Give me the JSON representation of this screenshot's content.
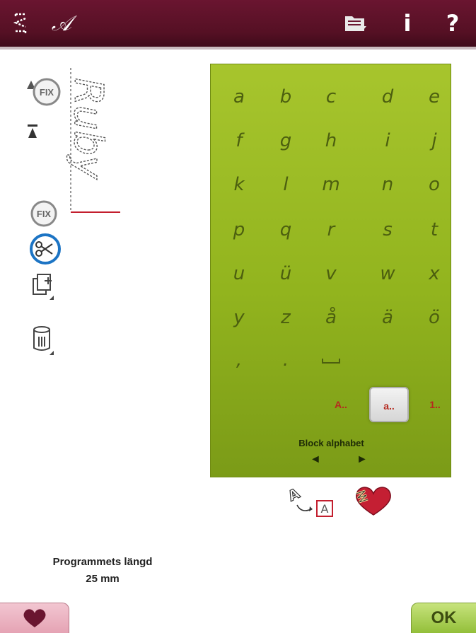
{
  "topbar": {
    "font_icon_glyph": "𝒜",
    "info_label": "i",
    "help_label": "?",
    "icons": [
      "stitch-menu-icon",
      "font-icon",
      "file-manager-icon",
      "info-icon",
      "help-icon"
    ]
  },
  "sidebar": {
    "fix_label": "FIX",
    "preview_text": "Ruby",
    "icons": [
      "fix-start-icon",
      "needle-stop-up-icon",
      "fix-end-icon",
      "scissors-icon",
      "duplicate-icon",
      "delete-icon"
    ]
  },
  "keyboard": {
    "rows": [
      [
        "a",
        "b",
        "c",
        "d",
        "e"
      ],
      [
        "f",
        "g",
        "h",
        "i",
        "j"
      ],
      [
        "k",
        "l",
        "m",
        "n",
        "o"
      ],
      [
        "p",
        "q",
        "r",
        "s",
        "t"
      ],
      [
        "u",
        "ü",
        "v",
        "w",
        "x"
      ],
      [
        "y",
        "z",
        "å",
        "ä",
        "ö"
      ]
    ],
    "punctuation": [
      ",",
      "."
    ],
    "modes": [
      "A..",
      "a..",
      "1.."
    ],
    "active_mode": "a..",
    "alphabet_label": "Block alphabet",
    "prev_arrow": "◄",
    "next_arrow": "►"
  },
  "tools": {
    "icons": [
      "convert-to-embroidery-icon",
      "heart-stitch-icon"
    ],
    "convert_letter": "A"
  },
  "program_length": {
    "label": "Programmets längd",
    "value": "25 mm"
  },
  "buttons": {
    "ok_label": "OK",
    "favorites_icon": "heart-icon"
  },
  "colors": {
    "topbar": "#551024",
    "panel": "#92b41e",
    "mode_text": "#b52a1f",
    "ok_button": "#93bf3a",
    "heart_button": "#e5a3b4",
    "accent_blue": "#1c74c4"
  }
}
